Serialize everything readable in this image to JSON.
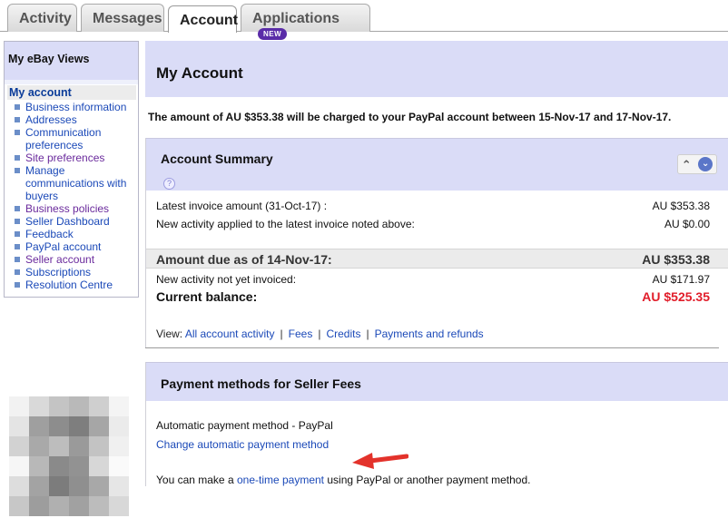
{
  "tabs": [
    {
      "label": "Activity"
    },
    {
      "label": "Messages"
    },
    {
      "label": "Account",
      "active": true
    },
    {
      "label": "Applications",
      "badge": "NEW"
    }
  ],
  "sidebar": {
    "title": "My eBay Views",
    "current": "My account",
    "items": [
      {
        "label": "Business information",
        "visited": false
      },
      {
        "label": "Addresses",
        "visited": false
      },
      {
        "label": "Communication preferences",
        "visited": false
      },
      {
        "label": "Site preferences",
        "visited": true
      },
      {
        "label": "Manage communications with buyers",
        "visited": false
      },
      {
        "label": "Business policies",
        "visited": true
      },
      {
        "label": "Seller Dashboard",
        "visited": false
      },
      {
        "label": "Feedback",
        "visited": false
      },
      {
        "label": "PayPal account",
        "visited": false
      },
      {
        "label": "Seller account",
        "visited": true
      },
      {
        "label": "Subscriptions",
        "visited": false
      },
      {
        "label": "Resolution Centre",
        "visited": false
      }
    ]
  },
  "main": {
    "title": "My Account",
    "notice": "The amount of AU $353.38 will be charged to your PayPal account between 15-Nov-17 and 17-Nov-17.",
    "summary": {
      "title": "Account Summary",
      "help": "?",
      "latest_invoice_label": "Latest invoice amount  (31-Oct-17) :",
      "latest_invoice_value": "AU $353.38",
      "new_activity_applied_label": "New activity applied to the latest invoice noted above:",
      "new_activity_applied_value": "AU $0.00",
      "amount_due_label": "Amount due as of 14-Nov-17:",
      "amount_due_value": "AU $353.38",
      "not_invoiced_label": "New activity not yet invoiced:",
      "not_invoiced_value": "AU $171.97",
      "current_balance_label": "Current balance:",
      "current_balance_value": "AU $525.35"
    },
    "view": {
      "prefix": "View:",
      "links": [
        "All account activity",
        "Fees",
        "Credits",
        "Payments and refunds"
      ]
    },
    "payment": {
      "title": "Payment methods for Seller Fees",
      "method": "Automatic payment method - PayPal",
      "change_link": "Change automatic payment method",
      "onetime_prefix": "You can make a",
      "onetime_link": "one-time payment",
      "onetime_suffix": "using PayPal or another payment method."
    }
  },
  "colors": {
    "header_band": "#dadcf7",
    "link": "#1b49b8",
    "visited_link": "#6a2a9c",
    "balance_red": "#e11d2a",
    "arrow_red": "#e3322b"
  }
}
